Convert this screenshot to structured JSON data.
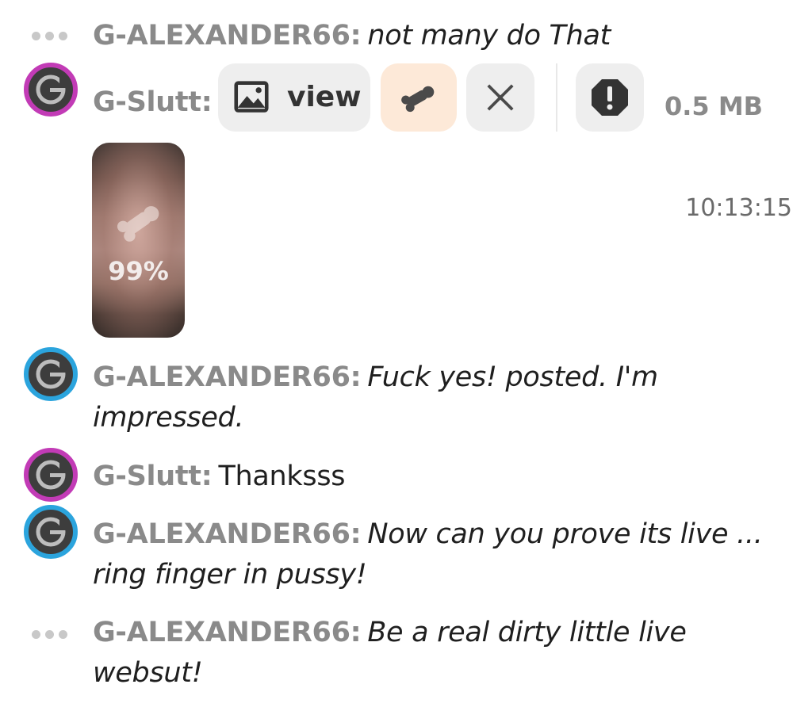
{
  "messages": [
    {
      "user": "G-ALEXANDER66:",
      "text": "not many do That",
      "style": "italic",
      "marker": "dots"
    },
    {
      "user": "G-Slutt:",
      "marker": "avatar-pink",
      "attachment": {
        "view_label": "view",
        "size": "0.5 MB",
        "timestamp": "10:13:15",
        "confidence": "99%"
      }
    },
    {
      "user": "G-ALEXANDER66:",
      "text_line1": "Fuck yes! posted. I'm",
      "text_line2": "impressed.",
      "style": "italic",
      "marker": "avatar-blue"
    },
    {
      "user": "G-Slutt:",
      "text": "Thanksss",
      "style": "normal",
      "marker": "avatar-pink"
    },
    {
      "user": "G-ALEXANDER66:",
      "text_line1": "Now can you prove its live ...",
      "text_line2": "ring finger in pussy!",
      "style": "italic",
      "marker": "avatar-blue"
    },
    {
      "user": "G-ALEXANDER66:",
      "text_line1": "Be a real dirty little live",
      "text_line2": "websut!",
      "style": "italic",
      "marker": "dots"
    }
  ],
  "icons": {
    "image": "image-icon",
    "phallus": "phallus-icon",
    "close": "close-icon",
    "report": "report-icon",
    "avatar_letter": "g-logo-icon"
  },
  "colors": {
    "username": "#8a8a8a",
    "avatar_pink_ring": "#c23bb6",
    "avatar_blue_ring": "#2ba4dd",
    "peach_pill": "#fde9d8",
    "gray_pill": "#eeeeee"
  }
}
